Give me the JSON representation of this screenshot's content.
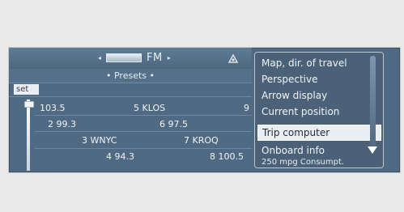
{
  "source": {
    "band": "FM"
  },
  "presets_label": "• Presets •",
  "set_label": "set",
  "presets": [
    {
      "num": "1",
      "name": "103.5"
    },
    {
      "num": "2",
      "name": "99.3"
    },
    {
      "num": "3",
      "name": "WNYC"
    },
    {
      "num": "4",
      "name": "94.3"
    },
    {
      "num": "5",
      "name": "KLOS"
    },
    {
      "num": "6",
      "name": "97.5"
    },
    {
      "num": "7",
      "name": "KROQ"
    },
    {
      "num": "8",
      "name": "100.5"
    },
    {
      "num": "9",
      "name": ""
    }
  ],
  "menu": {
    "items": [
      "Map, dir. of travel",
      "Perspective",
      "Arrow display",
      "Current position",
      "Trip computer",
      "Onboard info"
    ],
    "selected": "Trip computer"
  },
  "footer": "250 mpg  Consumpt.",
  "colors": {
    "screen": "#4f6a82",
    "selection": "#e9eef3"
  }
}
